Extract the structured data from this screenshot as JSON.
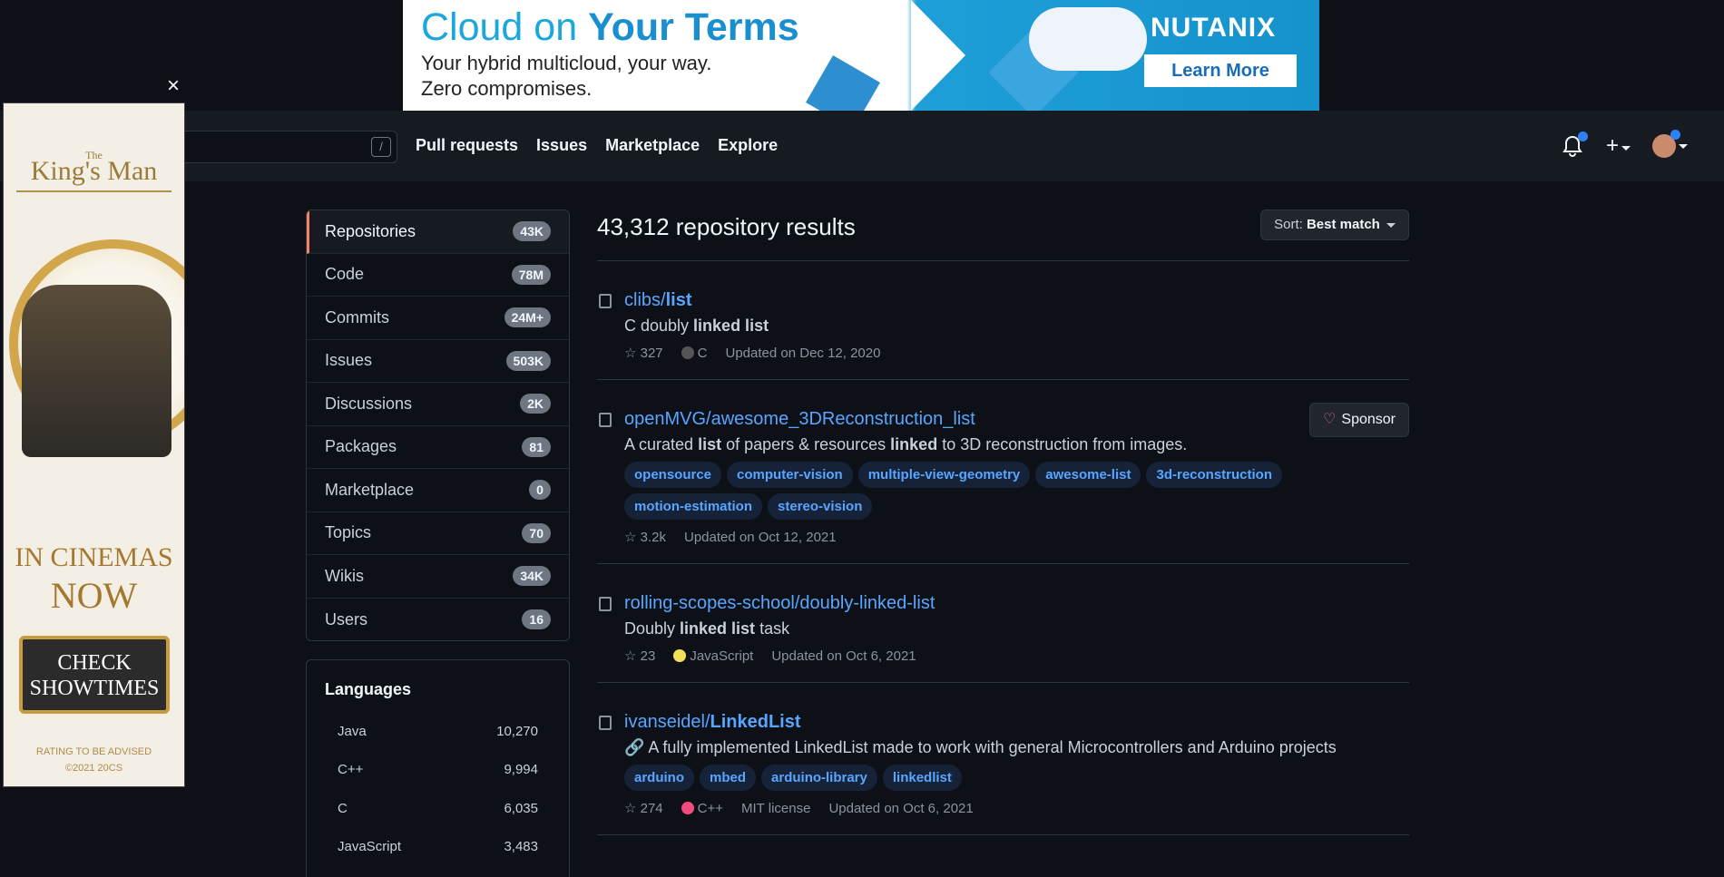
{
  "top_ad": {
    "headline_part1": "Cloud on ",
    "headline_part2": "Your Terms",
    "line1": "Your hybrid multicloud, your way.",
    "line2": "Zero compromises.",
    "brand": "NUTANIX",
    "cta": "Learn More"
  },
  "side_ad": {
    "title_small": "The",
    "title": "King's Man",
    "line1": "IN CINEMAS",
    "line2": "NOW",
    "cta_line1": "CHECK",
    "cta_line2": "SHOWTIMES",
    "fine1": "RATING TO BE ADVISED",
    "fine2": "©2021 20CS",
    "close": "×"
  },
  "header": {
    "search_shortcut": "/",
    "nav": [
      "Pull requests",
      "Issues",
      "Marketplace",
      "Explore"
    ],
    "plus": "+"
  },
  "filters": [
    {
      "label": "Repositories",
      "count": "43K"
    },
    {
      "label": "Code",
      "count": "78M"
    },
    {
      "label": "Commits",
      "count": "24M+"
    },
    {
      "label": "Issues",
      "count": "503K"
    },
    {
      "label": "Discussions",
      "count": "2K"
    },
    {
      "label": "Packages",
      "count": "81"
    },
    {
      "label": "Marketplace",
      "count": "0"
    },
    {
      "label": "Topics",
      "count": "70"
    },
    {
      "label": "Wikis",
      "count": "34K"
    },
    {
      "label": "Users",
      "count": "16"
    }
  ],
  "languages": {
    "title": "Languages",
    "items": [
      {
        "name": "Java",
        "count": "10,270"
      },
      {
        "name": "C++",
        "count": "9,994"
      },
      {
        "name": "C",
        "count": "6,035"
      },
      {
        "name": "JavaScript",
        "count": "3,483"
      }
    ]
  },
  "results": {
    "title": "43,312 repository results",
    "sort_prefix": "Sort: ",
    "sort_value": "Best match",
    "repos": [
      {
        "owner": "clibs/",
        "name": "list",
        "desc_html": "C doubly <b>linked list</b>",
        "topics": [],
        "stars": "327",
        "lang": "C",
        "lang_color": "#555555",
        "license": "",
        "updated": "Updated on Dec 12, 2020",
        "sponsor": false
      },
      {
        "owner": "openMVG/",
        "name": "awesome_3DReconstruction_list",
        "desc_html": "A curated <b>list</b> of papers &amp; resources <b>linked</b> to 3D reconstruction from images.",
        "topics": [
          "opensource",
          "computer-vision",
          "multiple-view-geometry",
          "awesome-list",
          "3d-reconstruction",
          "motion-estimation",
          "stereo-vision"
        ],
        "stars": "3.2k",
        "lang": "",
        "lang_color": "",
        "license": "",
        "updated": "Updated on Oct 12, 2021",
        "sponsor": true,
        "sponsor_label": "Sponsor"
      },
      {
        "owner": "rolling-scopes-school/",
        "name": "doubly-linked-list",
        "desc_html": "Doubly <b>linked list</b> task",
        "topics": [],
        "stars": "23",
        "lang": "JavaScript",
        "lang_color": "#f1e05a",
        "license": "",
        "updated": "Updated on Oct 6, 2021",
        "sponsor": false
      },
      {
        "owner": "ivanseidel/",
        "name": "LinkedList",
        "desc_html": "🔗 A fully implemented LinkedList made to work with general Microcontrollers and Arduino projects",
        "topics": [
          "arduino",
          "mbed",
          "arduino-library",
          "linkedlist"
        ],
        "stars": "274",
        "lang": "C++",
        "lang_color": "#f34b7d",
        "license": "MIT license",
        "updated": "Updated on Oct 6, 2021",
        "sponsor": false
      }
    ]
  },
  "colors": {
    "accent": "#58a6ff",
    "active_border": "#f78166",
    "background": "#0d1117"
  }
}
